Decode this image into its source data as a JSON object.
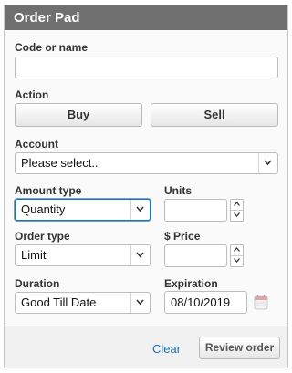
{
  "header": {
    "title": "Order Pad"
  },
  "code": {
    "label": "Code or name",
    "value": "",
    "placeholder": ""
  },
  "action": {
    "label": "Action",
    "buy_label": "Buy",
    "sell_label": "Sell"
  },
  "account": {
    "label": "Account",
    "selected": "Please select.."
  },
  "amount_type": {
    "label": "Amount type",
    "selected": "Quantity"
  },
  "units": {
    "label": "Units",
    "value": ""
  },
  "order_type": {
    "label": "Order type",
    "selected": "Limit"
  },
  "price": {
    "label": "$ Price",
    "value": ""
  },
  "duration": {
    "label": "Duration",
    "selected": "Good Till Date"
  },
  "expiration": {
    "label": "Expiration",
    "value": "08/10/2019",
    "icon": "calendar-icon"
  },
  "footer": {
    "clear_label": "Clear",
    "review_label": "Review order"
  },
  "colors": {
    "titlebar": "#6f6f6f",
    "link": "#1c6fb0",
    "focus": "#1c73b7"
  }
}
